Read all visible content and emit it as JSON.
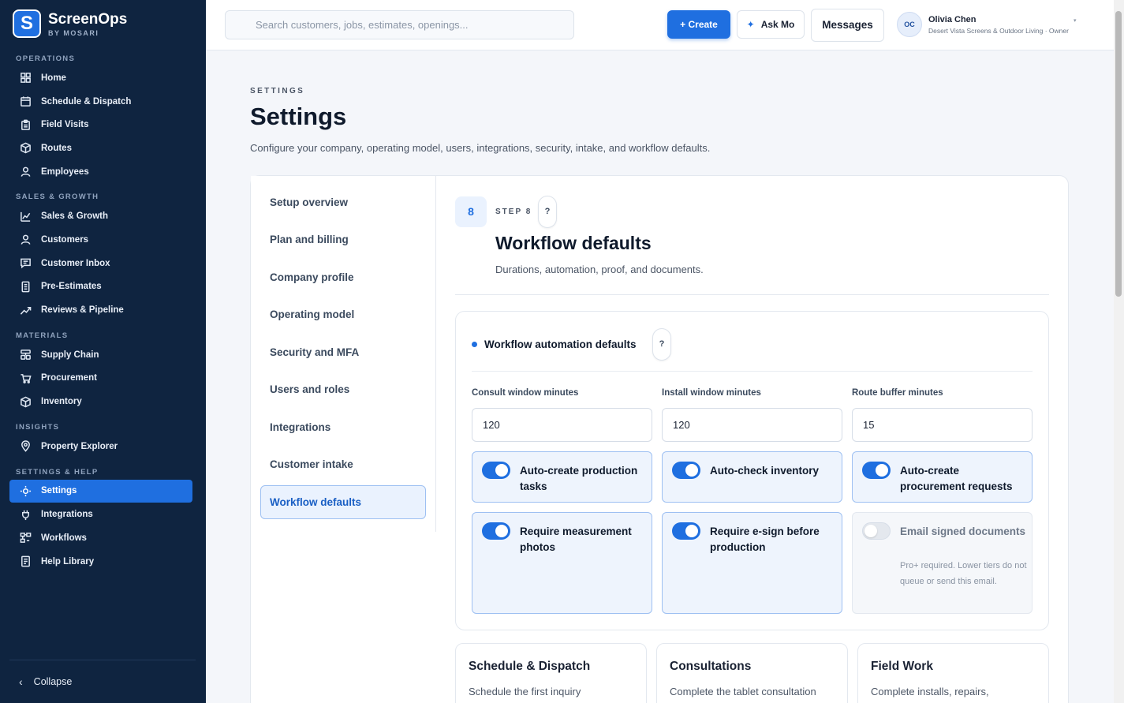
{
  "brand": {
    "logo_letter": "S",
    "name": "ScreenOps",
    "sub": "BY MOSARI"
  },
  "sidebar": {
    "sections": [
      {
        "title": "OPERATIONS",
        "items": [
          {
            "label": "Home",
            "icon": "grid-icon"
          },
          {
            "label": "Schedule & Dispatch",
            "icon": "calendar-icon"
          },
          {
            "label": "Field Visits",
            "icon": "clipboard-icon"
          },
          {
            "label": "Routes",
            "icon": "cube-icon"
          },
          {
            "label": "Employees",
            "icon": "user-icon"
          }
        ]
      },
      {
        "title": "SALES & GROWTH",
        "items": [
          {
            "label": "Sales & Growth",
            "icon": "chart-icon"
          },
          {
            "label": "Customers",
            "icon": "user-icon"
          },
          {
            "label": "Customer Inbox",
            "icon": "chat-icon"
          },
          {
            "label": "Pre-Estimates",
            "icon": "document-icon"
          },
          {
            "label": "Reviews & Pipeline",
            "icon": "trend-icon"
          }
        ]
      },
      {
        "title": "MATERIALS",
        "items": [
          {
            "label": "Supply Chain",
            "icon": "layers-icon"
          },
          {
            "label": "Procurement",
            "icon": "cart-icon"
          },
          {
            "label": "Inventory",
            "icon": "cube-icon"
          }
        ]
      },
      {
        "title": "INSIGHTS",
        "items": [
          {
            "label": "Property Explorer",
            "icon": "pin-icon"
          }
        ]
      },
      {
        "title": "SETTINGS & HELP",
        "items": [
          {
            "label": "Settings",
            "icon": "sun-icon",
            "active": true
          },
          {
            "label": "Integrations",
            "icon": "plug-icon"
          },
          {
            "label": "Workflows",
            "icon": "workflow-icon"
          },
          {
            "label": "Help Library",
            "icon": "book-icon"
          }
        ]
      }
    ],
    "collapse_label": "Collapse"
  },
  "topbar": {
    "search_placeholder": "Search customers, jobs, estimates, openings...",
    "create_label": "+ Create",
    "ask_label": "Ask Mo",
    "messages_label": "Messages",
    "user": {
      "initials": "OC",
      "name": "Olivia Chen",
      "org": "Desert Vista Screens & Outdoor Living · Owner"
    }
  },
  "page": {
    "eyebrow": "SETTINGS",
    "title": "Settings",
    "description": "Configure your company, operating model, users, integrations, security, intake, and workflow defaults."
  },
  "subnav": [
    {
      "label": "Setup overview"
    },
    {
      "label": "Plan and billing"
    },
    {
      "label": "Company profile"
    },
    {
      "label": "Operating model"
    },
    {
      "label": "Security and MFA"
    },
    {
      "label": "Users and roles"
    },
    {
      "label": "Integrations"
    },
    {
      "label": "Customer intake"
    },
    {
      "label": "Workflow defaults",
      "active": true
    }
  ],
  "step": {
    "number": "8",
    "label": "STEP 8",
    "help": "?",
    "title": "Workflow defaults",
    "description": "Durations, automation, proof, and documents."
  },
  "automation": {
    "title": "Workflow automation defaults",
    "help": "?",
    "fields": [
      {
        "label": "Consult window minutes",
        "value": "120"
      },
      {
        "label": "Install window minutes",
        "value": "120"
      },
      {
        "label": "Route buffer minutes",
        "value": "15"
      }
    ],
    "options": [
      {
        "label": "Auto-create production tasks",
        "on": true
      },
      {
        "label": "Auto-check inventory",
        "on": true
      },
      {
        "label": "Auto-create procurement requests",
        "on": true
      },
      {
        "label": "Require measurement photos",
        "on": true
      },
      {
        "label": "Require e-sign before production",
        "on": true
      },
      {
        "label": "Email signed documents",
        "on": false,
        "note": "Pro+ required. Lower tiers do not queue or send this email."
      }
    ]
  },
  "cards": [
    {
      "title": "Schedule & Dispatch",
      "desc": "Schedule the first inquiry"
    },
    {
      "title": "Consultations",
      "desc": "Complete the tablet consultation"
    },
    {
      "title": "Field Work",
      "desc": "Complete installs, repairs,"
    }
  ]
}
